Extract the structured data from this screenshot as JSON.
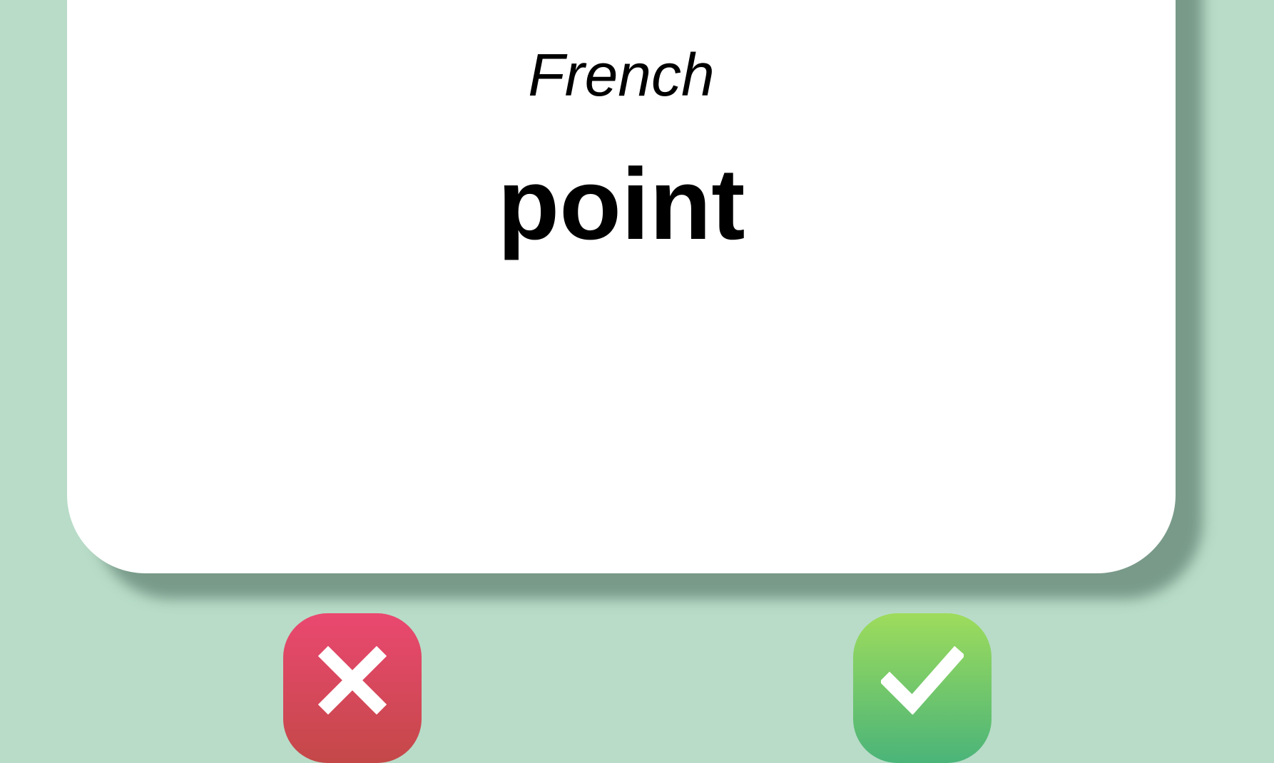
{
  "card": {
    "language": "French",
    "word": "point"
  },
  "buttons": {
    "wrong": {
      "icon": "close-icon",
      "color": "#e0485e"
    },
    "right": {
      "icon": "checkmark-icon",
      "color": "#6cc464"
    }
  },
  "colors": {
    "background": "#b8dcc8",
    "card": "#ffffff",
    "text": "#000000"
  }
}
